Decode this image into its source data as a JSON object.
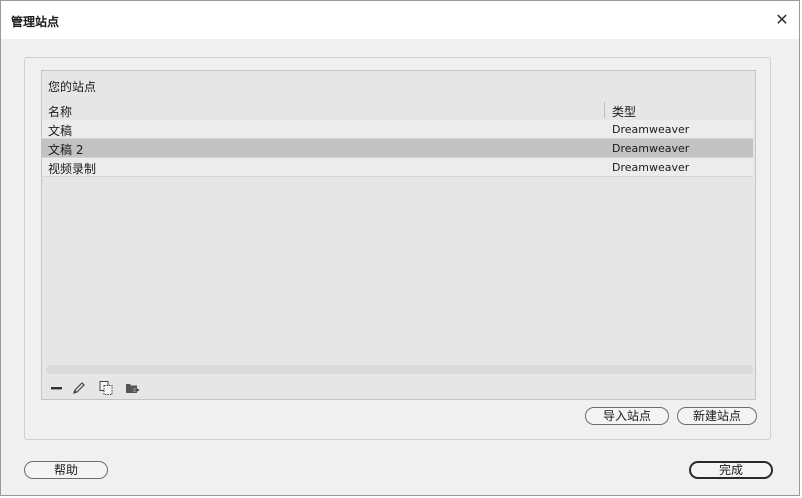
{
  "window": {
    "title": "管理站点",
    "close_glyph": "✕"
  },
  "sites": {
    "panel_title": "您的站点",
    "columns": {
      "name": "名称",
      "type": "类型"
    },
    "rows": [
      {
        "name": "文稿",
        "type": "Dreamweaver",
        "selected": false
      },
      {
        "name": "文稿 2",
        "type": "Dreamweaver",
        "selected": true
      },
      {
        "name": "视频录制",
        "type": "Dreamweaver",
        "selected": false
      }
    ],
    "toolbar_icons": [
      "minus-icon",
      "pencil-icon",
      "duplicate-icon",
      "export-folder-icon"
    ]
  },
  "buttons": {
    "import": "导入站点",
    "new_site": "新建站点",
    "help": "帮助",
    "done": "完成"
  }
}
